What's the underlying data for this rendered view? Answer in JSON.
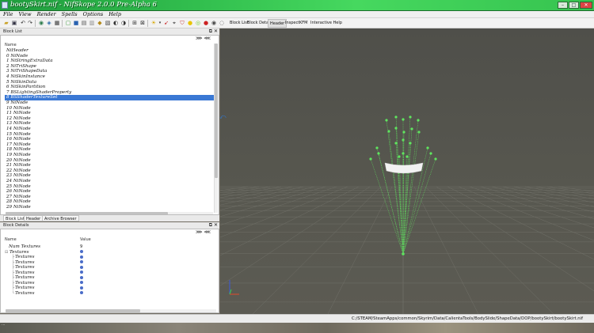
{
  "window": {
    "title": "bootySkirt.nif - NifSkope 2.0.0 Pre-Alpha 6",
    "minimize": "–",
    "maximize": "□",
    "close": "✕"
  },
  "menubar": [
    "File",
    "View",
    "Render",
    "Spells",
    "Options",
    "Help"
  ],
  "toolbar": {
    "icons": [
      "open-icon",
      "save-icon",
      "undo-icon",
      "redo-icon",
      "load-view-icon",
      "save-view-icon",
      "grid-icon",
      "frame-icon",
      "cube-icon",
      "light-icon",
      "eye-icon",
      "lighting-icon",
      "texture-icon",
      "vertex-icon",
      "sun-icon",
      "arrow-icon",
      "select-icon",
      "shield-icon",
      "info-icon",
      "target-icon",
      "record-icon",
      "camera-icon"
    ],
    "tabs": [
      "Block List",
      "Block Details",
      "Header",
      "Inspect",
      "KFM",
      "Interactive Help"
    ],
    "active_tab": "Header"
  },
  "block_list": {
    "title": "Block List",
    "column_name": "Name",
    "rows": [
      "NiHeader",
      "0 NiNode",
      "1 NiStringExtraData",
      "2 NiTriShape",
      "3 NiTriShapeData",
      "4 NiSkinInstance",
      "5 NiSkinData",
      "6 NiSkinPartition",
      "7 BSLightingShaderProperty",
      "8 BSShaderTextureSet",
      "9 NiNode",
      "10 NiNode",
      "11 NiNode",
      "12 NiNode",
      "13 NiNode",
      "14 NiNode",
      "15 NiNode",
      "16 NiNode",
      "17 NiNode",
      "18 NiNode",
      "19 NiNode",
      "20 NiNode",
      "21 NiNode",
      "22 NiNode",
      "23 NiNode",
      "24 NiNode",
      "25 NiNode",
      "26 NiNode",
      "27 NiNode",
      "28 NiNode",
      "29 NiNode"
    ],
    "selected_index": 9
  },
  "panel_tabs": [
    "Block List",
    "Header",
    "Archive Browser"
  ],
  "block_details": {
    "title": "Block Details",
    "column_name": "Name",
    "column_value": "Value",
    "rows": [
      {
        "name": "Num Textures",
        "value": "9",
        "glyph": ""
      },
      {
        "name": "Textures",
        "value": "",
        "glyph": "⊟"
      },
      {
        "name": "Textures",
        "value": "",
        "glyph": "├"
      },
      {
        "name": "Textures",
        "value": "",
        "glyph": "├"
      },
      {
        "name": "Textures",
        "value": "",
        "glyph": "├"
      },
      {
        "name": "Textures",
        "value": "",
        "glyph": "├"
      },
      {
        "name": "Textures",
        "value": "",
        "glyph": "├"
      },
      {
        "name": "Textures",
        "value": "",
        "glyph": "├"
      },
      {
        "name": "Textures",
        "value": "",
        "glyph": "├"
      },
      {
        "name": "Textures",
        "value": "",
        "glyph": "└"
      }
    ]
  },
  "status": {
    "path": "C:/STEAM/SteamApps/common/Skyrim/Data/CalientaTools/BodySlide/ShapeData/DOP/bootySkirt/bootySkirt.nif"
  },
  "colors": {
    "titlebar": "#33c04f",
    "selection": "#3a78d4",
    "viewport_bg": "#55554f",
    "bone_green": "#5fe65f"
  }
}
